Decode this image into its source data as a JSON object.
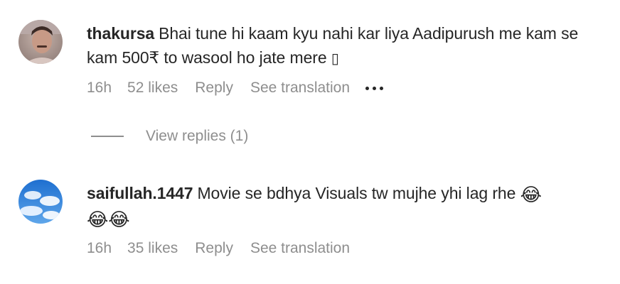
{
  "comments": [
    {
      "username": "thakursa",
      "text": "Bhai tune hi kaam kyu nahi kar liya Aadipurush me kam se kam 500₹ to wasool ho jate mere",
      "trailing_glyph": "▯",
      "time": "16h",
      "likes": "52 likes",
      "reply": "Reply",
      "translate": "See translation",
      "view_replies": "View replies (1)"
    },
    {
      "username": "saifullah.1447",
      "text": "Movie se bdhya Visuals tw mujhe yhi lag rhe",
      "emojis": [
        "😂",
        "😂",
        "😂"
      ],
      "time": "16h",
      "likes": "35 likes",
      "reply": "Reply",
      "translate": "See translation"
    }
  ],
  "icons": {
    "more": "more-options-icon",
    "emoji": "face-with-tears-of-joy"
  },
  "colors": {
    "text": "#262626",
    "secondary": "#8e8e8e",
    "background": "#ffffff"
  }
}
